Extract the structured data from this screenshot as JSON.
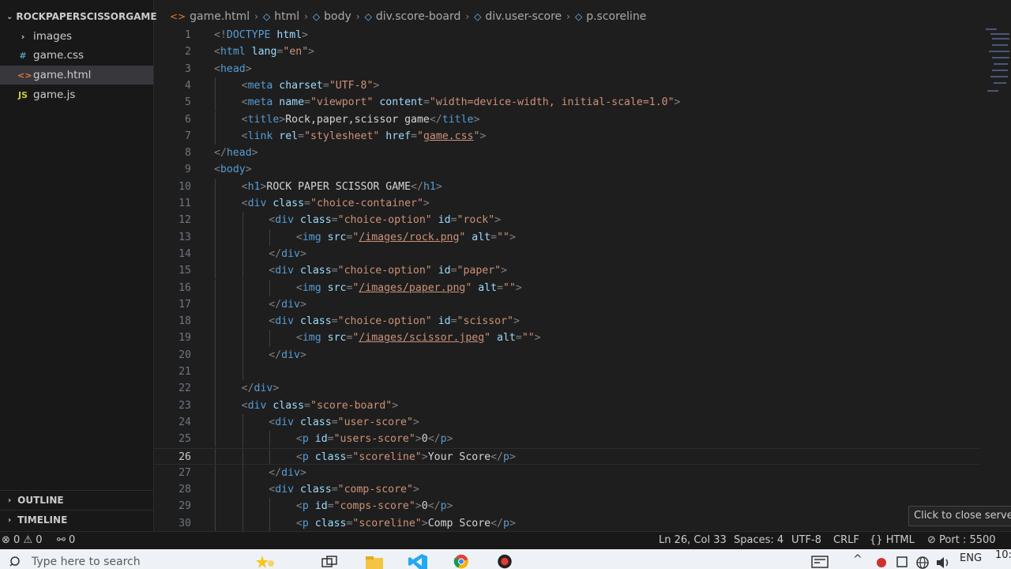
{
  "sidebar": {
    "title": "ROCKPAPERSCISSORGAME",
    "items": [
      {
        "label": "images",
        "icon": "chevron-right-icon",
        "glyph": "›",
        "color": "#cccccc",
        "selected": false
      },
      {
        "label": "game.css",
        "icon": "css-file-icon",
        "glyph": "#",
        "color": "#519aba",
        "selected": false
      },
      {
        "label": "game.html",
        "icon": "html-file-icon",
        "glyph": "<>",
        "color": "#e37933",
        "selected": true
      },
      {
        "label": "game.js",
        "icon": "js-file-icon",
        "glyph": "JS",
        "color": "#cbcb41",
        "selected": false
      }
    ],
    "outline": "OUTLINE",
    "timeline": "TIMELINE"
  },
  "breadcrumb": [
    {
      "label": "game.html",
      "icon": "html-file-icon"
    },
    {
      "label": "html",
      "icon": "symbol-element-icon"
    },
    {
      "label": "body",
      "icon": "symbol-element-icon"
    },
    {
      "label": "div.score-board",
      "icon": "symbol-element-icon"
    },
    {
      "label": "div.user-score",
      "icon": "symbol-element-icon"
    },
    {
      "label": "p.scoreline",
      "icon": "symbol-element-icon"
    }
  ],
  "editor": {
    "current_line": 26,
    "lines": [
      {
        "n": "1",
        "indent": 0,
        "tokens": [
          [
            "p",
            "<!"
          ],
          [
            "t",
            "DOCTYPE"
          ],
          [
            "a",
            " html"
          ],
          [
            "p",
            ">"
          ]
        ]
      },
      {
        "n": "2",
        "indent": 0,
        "tokens": [
          [
            "p",
            "<"
          ],
          [
            "t",
            "html"
          ],
          [
            "a",
            " lang"
          ],
          [
            "p",
            "="
          ],
          [
            "s",
            "\"en\""
          ],
          [
            "p",
            ">"
          ]
        ]
      },
      {
        "n": "3",
        "indent": 0,
        "tokens": [
          [
            "p",
            "<"
          ],
          [
            "t",
            "head"
          ],
          [
            "p",
            ">"
          ]
        ]
      },
      {
        "n": "4",
        "indent": 1,
        "tokens": [
          [
            "p",
            "<"
          ],
          [
            "t",
            "meta"
          ],
          [
            "a",
            " charset"
          ],
          [
            "p",
            "="
          ],
          [
            "s",
            "\"UTF-8\""
          ],
          [
            "p",
            ">"
          ]
        ]
      },
      {
        "n": "5",
        "indent": 1,
        "tokens": [
          [
            "p",
            "<"
          ],
          [
            "t",
            "meta"
          ],
          [
            "a",
            " name"
          ],
          [
            "p",
            "="
          ],
          [
            "s",
            "\"viewport\""
          ],
          [
            "a",
            " content"
          ],
          [
            "p",
            "="
          ],
          [
            "s",
            "\"width=device-width, initial-scale=1.0\""
          ],
          [
            "p",
            ">"
          ]
        ]
      },
      {
        "n": "6",
        "indent": 1,
        "tokens": [
          [
            "p",
            "<"
          ],
          [
            "t",
            "title"
          ],
          [
            "p",
            ">"
          ],
          [
            "x",
            "Rock,paper,scissor game"
          ],
          [
            "p",
            "</"
          ],
          [
            "t",
            "title"
          ],
          [
            "p",
            ">"
          ]
        ]
      },
      {
        "n": "7",
        "indent": 1,
        "tokens": [
          [
            "p",
            "<"
          ],
          [
            "t",
            "link"
          ],
          [
            "a",
            " rel"
          ],
          [
            "p",
            "="
          ],
          [
            "s",
            "\"stylesheet\""
          ],
          [
            "a",
            " href"
          ],
          [
            "p",
            "="
          ],
          [
            "s",
            "\""
          ],
          [
            "l",
            "game.css"
          ],
          [
            "s",
            "\""
          ],
          [
            "p",
            ">"
          ]
        ]
      },
      {
        "n": "8",
        "indent": 0,
        "tokens": [
          [
            "p",
            "</"
          ],
          [
            "t",
            "head"
          ],
          [
            "p",
            ">"
          ]
        ]
      },
      {
        "n": "9",
        "indent": 0,
        "tokens": [
          [
            "p",
            "<"
          ],
          [
            "t",
            "body"
          ],
          [
            "p",
            ">"
          ]
        ]
      },
      {
        "n": "10",
        "indent": 1,
        "tokens": [
          [
            "p",
            "<"
          ],
          [
            "t",
            "h1"
          ],
          [
            "p",
            ">"
          ],
          [
            "x",
            "ROCK PAPER SCISSOR GAME"
          ],
          [
            "p",
            "</"
          ],
          [
            "t",
            "h1"
          ],
          [
            "p",
            ">"
          ]
        ]
      },
      {
        "n": "11",
        "indent": 1,
        "tokens": [
          [
            "p",
            "<"
          ],
          [
            "t",
            "div"
          ],
          [
            "a",
            " class"
          ],
          [
            "p",
            "="
          ],
          [
            "s",
            "\"choice-container\""
          ],
          [
            "p",
            ">"
          ]
        ]
      },
      {
        "n": "12",
        "indent": 2,
        "tokens": [
          [
            "p",
            "<"
          ],
          [
            "t",
            "div"
          ],
          [
            "a",
            " class"
          ],
          [
            "p",
            "="
          ],
          [
            "s",
            "\"choice-option\""
          ],
          [
            "a",
            " id"
          ],
          [
            "p",
            "="
          ],
          [
            "s",
            "\"rock\""
          ],
          [
            "p",
            ">"
          ]
        ]
      },
      {
        "n": "13",
        "indent": 3,
        "tokens": [
          [
            "p",
            "<"
          ],
          [
            "t",
            "img"
          ],
          [
            "a",
            " src"
          ],
          [
            "p",
            "="
          ],
          [
            "s",
            "\""
          ],
          [
            "l",
            "/images/rock.png"
          ],
          [
            "s",
            "\""
          ],
          [
            "a",
            " alt"
          ],
          [
            "p",
            "="
          ],
          [
            "s",
            "\"\""
          ],
          [
            "p",
            ">"
          ]
        ]
      },
      {
        "n": "14",
        "indent": 2,
        "tokens": [
          [
            "p",
            "</"
          ],
          [
            "t",
            "div"
          ],
          [
            "p",
            ">"
          ]
        ]
      },
      {
        "n": "15",
        "indent": 2,
        "tokens": [
          [
            "p",
            "<"
          ],
          [
            "t",
            "div"
          ],
          [
            "a",
            " class"
          ],
          [
            "p",
            "="
          ],
          [
            "s",
            "\"choice-option\""
          ],
          [
            "a",
            " id"
          ],
          [
            "p",
            "="
          ],
          [
            "s",
            "\"paper\""
          ],
          [
            "p",
            ">"
          ]
        ]
      },
      {
        "n": "16",
        "indent": 3,
        "tokens": [
          [
            "p",
            "<"
          ],
          [
            "t",
            "img"
          ],
          [
            "a",
            " src"
          ],
          [
            "p",
            "="
          ],
          [
            "s",
            "\""
          ],
          [
            "l",
            "/images/paper.png"
          ],
          [
            "s",
            "\""
          ],
          [
            "a",
            " alt"
          ],
          [
            "p",
            "="
          ],
          [
            "s",
            "\"\""
          ],
          [
            "p",
            ">"
          ]
        ]
      },
      {
        "n": "17",
        "indent": 2,
        "tokens": [
          [
            "p",
            "</"
          ],
          [
            "t",
            "div"
          ],
          [
            "p",
            ">"
          ]
        ]
      },
      {
        "n": "18",
        "indent": 2,
        "tokens": [
          [
            "p",
            "<"
          ],
          [
            "t",
            "div"
          ],
          [
            "a",
            " class"
          ],
          [
            "p",
            "="
          ],
          [
            "s",
            "\"choice-option\""
          ],
          [
            "a",
            " id"
          ],
          [
            "p",
            "="
          ],
          [
            "s",
            "\"scissor\""
          ],
          [
            "p",
            ">"
          ]
        ]
      },
      {
        "n": "19",
        "indent": 3,
        "tokens": [
          [
            "p",
            "<"
          ],
          [
            "t",
            "img"
          ],
          [
            "a",
            " src"
          ],
          [
            "p",
            "="
          ],
          [
            "s",
            "\""
          ],
          [
            "l",
            "/images/scissor.jpeg"
          ],
          [
            "s",
            "\""
          ],
          [
            "a",
            " alt"
          ],
          [
            "p",
            "="
          ],
          [
            "s",
            "\"\""
          ],
          [
            "p",
            ">"
          ]
        ]
      },
      {
        "n": "20",
        "indent": 2,
        "tokens": [
          [
            "p",
            "</"
          ],
          [
            "t",
            "div"
          ],
          [
            "p",
            ">"
          ]
        ]
      },
      {
        "n": "21",
        "indent": 2,
        "tokens": []
      },
      {
        "n": "22",
        "indent": 1,
        "tokens": [
          [
            "p",
            "</"
          ],
          [
            "t",
            "div"
          ],
          [
            "p",
            ">"
          ]
        ]
      },
      {
        "n": "23",
        "indent": 1,
        "tokens": [
          [
            "p",
            "<"
          ],
          [
            "t",
            "div"
          ],
          [
            "a",
            " class"
          ],
          [
            "p",
            "="
          ],
          [
            "s",
            "\"score-board\""
          ],
          [
            "p",
            ">"
          ]
        ]
      },
      {
        "n": "24",
        "indent": 2,
        "tokens": [
          [
            "p",
            "<"
          ],
          [
            "t",
            "div"
          ],
          [
            "a",
            " class"
          ],
          [
            "p",
            "="
          ],
          [
            "s",
            "\"user-score\""
          ],
          [
            "p",
            ">"
          ]
        ]
      },
      {
        "n": "25",
        "indent": 3,
        "tokens": [
          [
            "p",
            "<"
          ],
          [
            "t",
            "p"
          ],
          [
            "a",
            " id"
          ],
          [
            "p",
            "="
          ],
          [
            "s",
            "\"users-score\""
          ],
          [
            "p",
            ">"
          ],
          [
            "x",
            "0"
          ],
          [
            "p",
            "</"
          ],
          [
            "t",
            "p"
          ],
          [
            "p",
            ">"
          ]
        ]
      },
      {
        "n": "26",
        "indent": 3,
        "tokens": [
          [
            "p",
            "<"
          ],
          [
            "t",
            "p"
          ],
          [
            "a",
            " class"
          ],
          [
            "p",
            "="
          ],
          [
            "s",
            "\"scoreline\""
          ],
          [
            "p",
            ">"
          ],
          [
            "x",
            "Your Score"
          ],
          [
            "p",
            "</"
          ],
          [
            "t",
            "p"
          ],
          [
            "p",
            ">"
          ]
        ]
      },
      {
        "n": "27",
        "indent": 2,
        "tokens": [
          [
            "p",
            "</"
          ],
          [
            "t",
            "div"
          ],
          [
            "p",
            ">"
          ]
        ]
      },
      {
        "n": "28",
        "indent": 2,
        "tokens": [
          [
            "p",
            "<"
          ],
          [
            "t",
            "div"
          ],
          [
            "a",
            " class"
          ],
          [
            "p",
            "="
          ],
          [
            "s",
            "\"comp-score\""
          ],
          [
            "p",
            ">"
          ]
        ]
      },
      {
        "n": "29",
        "indent": 3,
        "tokens": [
          [
            "p",
            "<"
          ],
          [
            "t",
            "p"
          ],
          [
            "a",
            " id"
          ],
          [
            "p",
            "="
          ],
          [
            "s",
            "\"comps-score\""
          ],
          [
            "p",
            ">"
          ],
          [
            "x",
            "0"
          ],
          [
            "p",
            "</"
          ],
          [
            "t",
            "p"
          ],
          [
            "p",
            ">"
          ]
        ]
      },
      {
        "n": "30",
        "indent": 3,
        "tokens": [
          [
            "p",
            "<"
          ],
          [
            "t",
            "p"
          ],
          [
            "a",
            " class"
          ],
          [
            "p",
            "="
          ],
          [
            "s",
            "\"scoreline\""
          ],
          [
            "p",
            ">"
          ],
          [
            "x",
            "Comp Score"
          ],
          [
            "p",
            "</"
          ],
          [
            "t",
            "p"
          ],
          [
            "p",
            ">"
          ]
        ]
      }
    ]
  },
  "tooltip": "Click to close server",
  "statusbar": {
    "errors": "0",
    "warnings": "0",
    "ports": "0",
    "position": "Ln 26, Col 33",
    "spaces": "Spaces: 4",
    "encoding": "UTF-8",
    "eol": "CRLF",
    "language": "HTML",
    "port": "Port : 5500"
  },
  "taskbar": {
    "search_placeholder": "Type here to search",
    "lang": "ENG",
    "clock": "10:"
  },
  "colors": {
    "editor_bg": "#1e1e1e",
    "sidebar_bg": "#181818",
    "selection_bg": "#37373d",
    "tag": "#569cd6",
    "attr": "#9cdcfe",
    "string": "#ce9178",
    "punctuation": "#808080",
    "text": "#d4d4d4"
  }
}
